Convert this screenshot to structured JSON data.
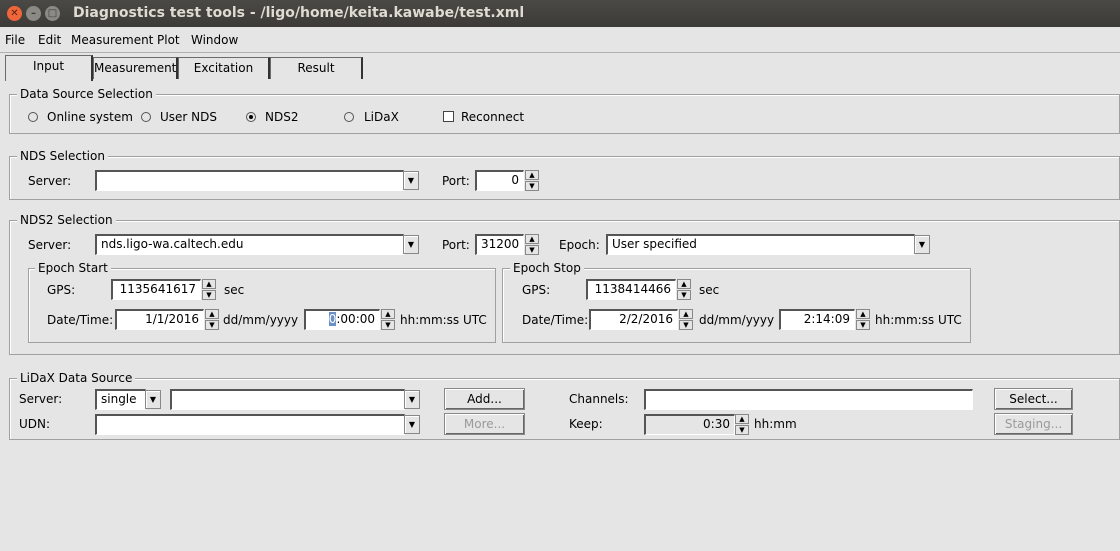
{
  "window": {
    "title": "Diagnostics test tools - /ligo/home/keita.kawabe/test.xml"
  },
  "menu": [
    "File",
    "Edit",
    "Measurement",
    "Plot",
    "Window"
  ],
  "tabs": [
    "Input",
    "Measurement",
    "Excitation",
    "Result"
  ],
  "data_source": {
    "title": "Data Source Selection",
    "options": [
      "Online system",
      "User NDS",
      "NDS2",
      "LiDaX"
    ],
    "selected": "NDS2",
    "reconnect_label": "Reconnect",
    "reconnect_checked": false
  },
  "nds": {
    "title": "NDS Selection",
    "server_label": "Server:",
    "server_value": "",
    "port_label": "Port:",
    "port_value": "0"
  },
  "nds2": {
    "title": "NDS2 Selection",
    "server_label": "Server:",
    "server_value": "nds.ligo-wa.caltech.edu",
    "port_label": "Port:",
    "port_value": "31200",
    "epoch_label": "Epoch:",
    "epoch_value": "User specified",
    "start": {
      "title": "Epoch Start",
      "gps_label": "GPS:",
      "gps_value": "1135641617",
      "gps_unit": "sec",
      "date_label": "Date/Time:",
      "date_value": "1/1/2016",
      "date_unit": "dd/mm/yyyy",
      "time_cursor": "0",
      "time_value": ":00:00",
      "time_unit": "hh:mm:ss UTC"
    },
    "stop": {
      "title": "Epoch Stop",
      "gps_label": "GPS:",
      "gps_value": "1138414466",
      "gps_unit": "sec",
      "date_label": "Date/Time:",
      "date_value": "2/2/2016",
      "date_unit": "dd/mm/yyyy",
      "time_value": "2:14:09",
      "time_unit": "hh:mm:ss UTC"
    }
  },
  "lidax": {
    "title": "LiDaX Data Source",
    "server_label": "Server:",
    "server_mode": "single",
    "server_value": "",
    "udn_label": "UDN:",
    "udn_value": "",
    "add_label": "Add...",
    "more_label": "More...",
    "channels_label": "Channels:",
    "channels_value": "",
    "keep_label": "Keep:",
    "keep_value": "0:30",
    "keep_unit": "hh:mm",
    "select_label": "Select...",
    "staging_label": "Staging..."
  }
}
